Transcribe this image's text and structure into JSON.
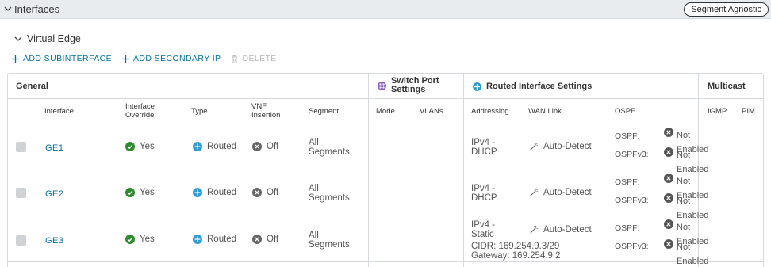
{
  "section": {
    "title": "Interfaces",
    "badge": "Segment Agnostic"
  },
  "subsection": {
    "title": "Virtual Edge"
  },
  "actions": {
    "add_subinterface": "ADD SUBINTERFACE",
    "add_secondary_ip": "ADD SECONDARY IP",
    "delete": "DELETE"
  },
  "groups": {
    "general": "General",
    "switch_port_line1": "Switch Port",
    "switch_port_line2": "Settings",
    "routed": "Routed Interface Settings",
    "multicast": "Multicast"
  },
  "columns": {
    "interface": "Interface",
    "override_line1": "Interface",
    "override_line2": "Override",
    "type": "Type",
    "vnf_line1": "VNF",
    "vnf_line2": "Insertion",
    "segment": "Segment",
    "mode": "Mode",
    "vlans": "VLANs",
    "addressing": "Addressing",
    "wan_link": "WAN Link",
    "ospf": "OSPF",
    "igmp": "IGMP",
    "pim": "PIM"
  },
  "rows": [
    {
      "name": "GE1",
      "override": "Yes",
      "type": "Routed",
      "vnf": "Off",
      "segment_line1": "All",
      "segment_line2": "Segments",
      "addr_line1": "IPv4 -",
      "addr_line2": "DHCP",
      "cidr": "",
      "gateway": "",
      "wan_link": "Auto-Detect",
      "ospf_label": "OSPF:",
      "ospf_v1": "Not",
      "ospf_v2": "Enabled",
      "ospfv3_label": "OSPFv3:",
      "ospfv3_v1": "Not",
      "ospfv3_v2": "Enabled"
    },
    {
      "name": "GE2",
      "override": "Yes",
      "type": "Routed",
      "vnf": "Off",
      "segment_line1": "All",
      "segment_line2": "Segments",
      "addr_line1": "IPv4 -",
      "addr_line2": "DHCP",
      "cidr": "",
      "gateway": "",
      "wan_link": "Auto-Detect",
      "ospf_label": "OSPF:",
      "ospf_v1": "Not",
      "ospf_v2": "Enabled",
      "ospfv3_label": "OSPFv3:",
      "ospfv3_v1": "Not",
      "ospfv3_v2": "Enabled"
    },
    {
      "name": "GE3",
      "override": "Yes",
      "type": "Routed",
      "vnf": "Off",
      "segment_line1": "All",
      "segment_line2": "Segments",
      "addr_line1": "IPv4 -",
      "addr_line2": "Static",
      "cidr": "CIDR: 169.254.9.3/29",
      "gateway": "Gateway: 169.254.9.2",
      "wan_link": "Auto-Detect",
      "ospf_label": "OSPF:",
      "ospf_v1": "Not",
      "ospf_v2": "Enabled",
      "ospfv3_label": "OSPFv3:",
      "ospfv3_v1": "Not",
      "ospfv3_v2": "Enabled"
    }
  ],
  "colors": {
    "link": "#0072a3",
    "success": "#2e8b2e",
    "routed": "#2d9bd6",
    "off": "#666666",
    "switch_port": "#8c5fc2"
  }
}
